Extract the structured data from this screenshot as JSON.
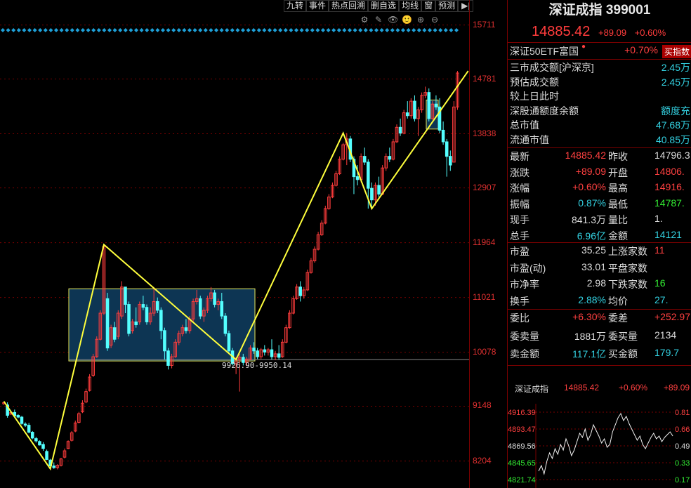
{
  "toolbar": {
    "buttons": [
      "九转",
      "事件",
      "热点回溯",
      "删自选",
      "均线",
      "窗",
      "预测"
    ],
    "end_icon": "▶|"
  },
  "tools": [
    "⚙",
    "✎",
    "👁",
    "🙂",
    "⊕",
    "⊖"
  ],
  "price_axis": {
    "labels": [
      "15711",
      "14781",
      "13838",
      "12907",
      "11964",
      "11021",
      "10078",
      "9148",
      "8204"
    ]
  },
  "annotation": {
    "box_label": "9926.90-9950.14"
  },
  "chart_data": {
    "type": "candlestick",
    "ylim": [
      7800,
      15900
    ],
    "y_ticks": [
      15711,
      14781,
      13838,
      12907,
      11964,
      11021,
      10078,
      9148,
      8204
    ],
    "reference_line": 9950,
    "rect_zone": [
      9926.9,
      11170
    ],
    "candles": [
      [
        9190,
        9230,
        9210,
        9170
      ],
      [
        9170,
        9215,
        8990,
        8950
      ],
      [
        9010,
        9060,
        9040,
        9000
      ],
      [
        9040,
        9090,
        8980,
        8960
      ],
      [
        8990,
        9010,
        8960,
        8940
      ],
      [
        8960,
        8980,
        8850,
        8830
      ],
      [
        8840,
        8870,
        8820,
        8790
      ],
      [
        8820,
        8860,
        8700,
        8680
      ],
      [
        8700,
        8720,
        8600,
        8580
      ],
      [
        8590,
        8620,
        8550,
        8520
      ],
      [
        8540,
        8560,
        8480,
        8470
      ],
      [
        8490,
        8530,
        8420,
        8380
      ],
      [
        8370,
        8400,
        8230,
        8220
      ],
      [
        8220,
        8240,
        8120,
        8110
      ],
      [
        8120,
        8180,
        8090,
        8070
      ],
      [
        8090,
        8150,
        8130,
        8060
      ],
      [
        8130,
        8260,
        8240,
        8110
      ],
      [
        8270,
        8420,
        8380,
        8250
      ],
      [
        8420,
        8560,
        8540,
        8410
      ],
      [
        8560,
        8720,
        8690,
        8540
      ],
      [
        8720,
        8900,
        8860,
        8700
      ],
      [
        8870,
        9050,
        9020,
        8850
      ],
      [
        9050,
        9250,
        9200,
        9030
      ],
      [
        9220,
        9450,
        9400,
        9200
      ],
      [
        9420,
        9700,
        9650,
        9400
      ],
      [
        9680,
        10050,
        10000,
        9650
      ],
      [
        10000,
        10350,
        10300,
        9980
      ],
      [
        10300,
        10800,
        10750,
        10280
      ],
      [
        10750,
        11930,
        11900,
        10720
      ],
      [
        11000,
        11100,
        10150,
        10100
      ],
      [
        10200,
        10550,
        10500,
        10150
      ],
      [
        10500,
        10600,
        10300,
        10250
      ],
      [
        10350,
        10800,
        10750,
        10300
      ],
      [
        10700,
        11300,
        11200,
        10650
      ],
      [
        11200,
        11150,
        10900,
        10750
      ],
      [
        10900,
        10950,
        10400,
        10350
      ],
      [
        10450,
        10650,
        10600,
        10400
      ],
      [
        10600,
        10850,
        10550,
        10500
      ],
      [
        10600,
        10950,
        10900,
        10550
      ],
      [
        10900,
        11050,
        10850,
        10800
      ],
      [
        10850,
        10900,
        10600,
        10550
      ],
      [
        10600,
        10850,
        10750,
        10550
      ],
      [
        10750,
        11200,
        10950,
        10700
      ],
      [
        10950,
        11020,
        10800,
        10750
      ],
      [
        10800,
        10850,
        10450,
        10300
      ],
      [
        10450,
        10500,
        10100,
        9950
      ],
      [
        10100,
        10150,
        9850,
        9780
      ],
      [
        9850,
        10050,
        10000,
        9800
      ],
      [
        10000,
        10300,
        10250,
        9980
      ],
      [
        10250,
        10450,
        10400,
        10200
      ],
      [
        10400,
        10550,
        10500,
        10350
      ],
      [
        10500,
        10650,
        10450,
        10400
      ],
      [
        10450,
        10700,
        10650,
        10400
      ],
      [
        10650,
        11000,
        10950,
        10600
      ],
      [
        10950,
        11150,
        11000,
        10900
      ],
      [
        11000,
        11050,
        10700,
        10650
      ],
      [
        10700,
        10850,
        10800,
        10600
      ],
      [
        10800,
        11050,
        11000,
        10750
      ],
      [
        11000,
        11200,
        11100,
        10950
      ],
      [
        11100,
        11150,
        10900,
        10850
      ],
      [
        10900,
        11000,
        10950,
        10800
      ],
      [
        10950,
        11100,
        10700,
        10650
      ],
      [
        10700,
        10750,
        10400,
        10350
      ],
      [
        10400,
        10450,
        10100,
        10050
      ],
      [
        10100,
        10150,
        9880,
        9850
      ],
      [
        9880,
        10000,
        9950,
        9700
      ],
      [
        9950,
        10050,
        9990,
        9400
      ],
      [
        9990,
        10050,
        9900,
        9850
      ],
      [
        9900,
        10000,
        9960,
        9850
      ],
      [
        9960,
        10200,
        10150,
        9940
      ],
      [
        10150,
        10250,
        10100,
        10050
      ],
      [
        10100,
        10150,
        10000,
        9960
      ],
      [
        10000,
        10150,
        10120,
        9960
      ],
      [
        10120,
        10200,
        10080,
        10020
      ],
      [
        10080,
        10150,
        10120,
        10020
      ],
      [
        10120,
        10300,
        10000,
        9950
      ],
      [
        10000,
        10100,
        10050,
        9940
      ],
      [
        10050,
        10200,
        9990,
        9950
      ],
      [
        10000,
        10300,
        10250,
        9980
      ],
      [
        10250,
        10550,
        10500,
        10230
      ],
      [
        10500,
        10800,
        10750,
        10480
      ],
      [
        10750,
        11050,
        11000,
        10730
      ],
      [
        11000,
        11250,
        11200,
        10980
      ],
      [
        11200,
        11300,
        11050,
        10950
      ],
      [
        11050,
        11200,
        11150,
        11000
      ],
      [
        11150,
        11500,
        11450,
        11130
      ],
      [
        11450,
        11700,
        11650,
        11430
      ],
      [
        11650,
        11900,
        11850,
        11620
      ],
      [
        11850,
        12150,
        12100,
        11830
      ],
      [
        12100,
        12350,
        12300,
        12080
      ],
      [
        12300,
        12600,
        12550,
        12280
      ],
      [
        12550,
        12800,
        12750,
        12530
      ],
      [
        12750,
        13000,
        12950,
        12730
      ],
      [
        12950,
        13200,
        13150,
        12930
      ],
      [
        13150,
        13450,
        13400,
        13130
      ],
      [
        13400,
        13680,
        13650,
        13380
      ],
      [
        13650,
        13850,
        13750,
        13300
      ],
      [
        13750,
        13800,
        13400,
        13350
      ],
      [
        13400,
        13450,
        13100,
        12800
      ],
      [
        13100,
        13300,
        13050,
        12950
      ],
      [
        13050,
        13500,
        13450,
        13000
      ],
      [
        13450,
        13600,
        13350,
        13300
      ],
      [
        13350,
        13400,
        12900,
        12550
      ],
      [
        12900,
        13000,
        12700,
        12550
      ],
      [
        12700,
        13000,
        12950,
        12600
      ],
      [
        12950,
        13100,
        12800,
        12750
      ],
      [
        12800,
        13300,
        13250,
        12780
      ],
      [
        13250,
        13500,
        13450,
        13200
      ],
      [
        13450,
        13600,
        13400,
        13350
      ],
      [
        13400,
        13750,
        13700,
        13380
      ],
      [
        13700,
        14000,
        13950,
        13680
      ],
      [
        13950,
        14100,
        13850,
        13800
      ],
      [
        13850,
        14250,
        14200,
        13830
      ],
      [
        14200,
        14400,
        14150,
        14100
      ],
      [
        14150,
        14450,
        14400,
        14100
      ],
      [
        14400,
        14500,
        14100,
        14050
      ],
      [
        14100,
        14300,
        14250,
        13800
      ],
      [
        14250,
        14550,
        14500,
        14200
      ],
      [
        14500,
        14650,
        14550,
        14450
      ],
      [
        14550,
        14620,
        14100,
        14050
      ],
      [
        14100,
        14400,
        14350,
        14080
      ],
      [
        14350,
        14500,
        14300,
        14250
      ],
      [
        14300,
        14450,
        13900,
        13850
      ],
      [
        13900,
        14050,
        13700,
        13650
      ],
      [
        13700,
        13750,
        13450,
        13100
      ],
      [
        13450,
        13550,
        13300,
        13200
      ],
      [
        13350,
        14400,
        14300,
        13350
      ],
      [
        14300,
        14920,
        14885,
        14250
      ]
    ]
  },
  "side": {
    "title": "深证成指 399001",
    "price": "14885.42",
    "change": "+89.09",
    "change_pct": "+0.60%",
    "etf_label": "深证50ETF富国",
    "etf_pct": "+0.70%",
    "buy_tag": "买指数",
    "info_rows": [
      {
        "label": "三市成交额[沪深京]",
        "value": "2.45万"
      },
      {
        "label": "预估成交额",
        "value": "2.45万"
      },
      {
        "label": "较上日此时",
        "value": ""
      },
      {
        "label": "深股通额度余额",
        "value": "额度充"
      },
      {
        "label": "总市值",
        "value": "47.68万"
      },
      {
        "label": "流通市值",
        "value": "40.85万"
      }
    ],
    "quote_rows": [
      {
        "l1": "最新",
        "v1": "14885.42",
        "c1": "red",
        "l2": "昨收",
        "v2": "14796.3",
        "c2": "white"
      },
      {
        "l1": "涨跌",
        "v1": "+89.09",
        "c1": "red",
        "l2": "开盘",
        "v2": "14806.",
        "c2": "red"
      },
      {
        "l1": "涨幅",
        "v1": "+0.60%",
        "c1": "red",
        "l2": "最高",
        "v2": "14916.",
        "c2": "red"
      },
      {
        "l1": "振幅",
        "v1": "0.87%",
        "c1": "cyan",
        "l2": "最低",
        "v2": "14787.",
        "c2": "green"
      },
      {
        "l1": "现手",
        "v1": "841.3万",
        "c1": "white",
        "l2": "量比",
        "v2": "1.",
        "c2": "white"
      },
      {
        "l1": "总手",
        "v1": "6.96亿",
        "c1": "cyan",
        "l2": "金额",
        "v2": "14121",
        "c2": "cyan"
      }
    ],
    "stat_rows": [
      {
        "l1": "市盈",
        "v1": "35.25",
        "c1": "white",
        "l2": "上涨家数",
        "v2": "11",
        "c2": "red"
      },
      {
        "l1": "市盈(动)",
        "v1": "33.01",
        "c1": "white",
        "l2": "平盘家数",
        "v2": "",
        "c2": "white"
      },
      {
        "l1": "市净率",
        "v1": "2.98",
        "c1": "white",
        "l2": "下跌家数",
        "v2": "16",
        "c2": "green"
      },
      {
        "l1": "换手",
        "v1": "2.88%",
        "c1": "cyan",
        "l2": "均价",
        "v2": "27.",
        "c2": "cyan"
      }
    ],
    "order_rows": [
      {
        "l1": "委比",
        "v1": "+6.30%",
        "c1": "red",
        "l2": "委差",
        "v2": "+252.97",
        "c2": "red"
      },
      {
        "l1": "委卖量",
        "v1": "1881万",
        "c1": "white",
        "l2": "委买量",
        "v2": "2134",
        "c2": "white"
      },
      {
        "l1": "卖金额",
        "v1": "117.1亿",
        "c1": "cyan",
        "l2": "买金额",
        "v2": "179.7",
        "c2": "cyan"
      }
    ],
    "mini": {
      "name": "深证成指",
      "price": "14885.42",
      "pct": "+0.60%",
      "chg": "+89.09",
      "left_ticks": [
        "4916.39",
        "4893.47",
        "4869.56",
        "4845.65",
        "4821.74"
      ],
      "right_ticks": [
        "0.81",
        "0.66",
        "0.49",
        "0.33",
        "0.17"
      ]
    }
  }
}
